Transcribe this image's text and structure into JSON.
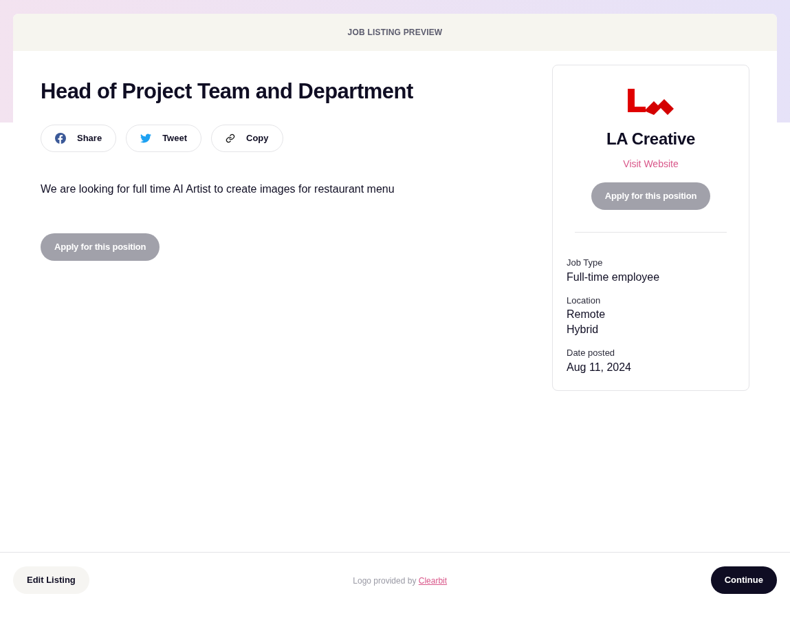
{
  "header": {
    "title": "JOB LISTING PREVIEW"
  },
  "job": {
    "title": "Head of Project Team and Department",
    "share_buttons": [
      {
        "kind": "facebook",
        "label": "Share"
      },
      {
        "kind": "twitter",
        "label": "Tweet"
      },
      {
        "kind": "link",
        "label": "Copy"
      }
    ],
    "description": "We are looking for full time AI Artist to create images for restaurant menu",
    "apply_button": {
      "label": "Apply for this position",
      "disabled": true
    }
  },
  "company": {
    "name": "LA Creative",
    "website_link": "Visit Website",
    "apply_button": {
      "label": "Apply for this position",
      "disabled": true
    },
    "details": [
      {
        "label": "Job Type",
        "values": [
          "Full-time employee"
        ]
      },
      {
        "label": "Location",
        "values": [
          "Remote",
          "Hybrid"
        ]
      },
      {
        "label": "Date posted",
        "values": [
          "Aug 11, 2024"
        ]
      }
    ]
  },
  "footer": {
    "edit_button": "Edit Listing",
    "credit_text": "Logo provided by",
    "credit_link": "Clearbit",
    "continue_button": "Continue"
  }
}
